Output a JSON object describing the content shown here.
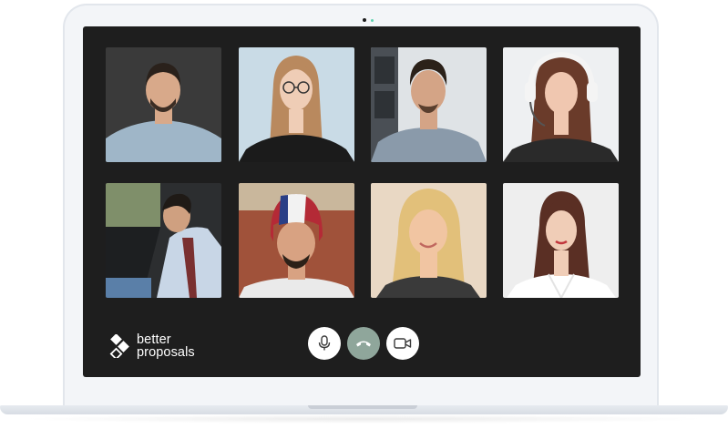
{
  "brand": {
    "line1": "better",
    "line2": "proposals"
  },
  "participants": [
    {
      "id": "p1",
      "bg": "#3a3a3a",
      "skin": "#d8a98a",
      "hair": "#2a211b",
      "shirt": "#9fb6c8"
    },
    {
      "id": "p2",
      "bg": "#c9dbe6",
      "skin": "#efcdb6",
      "hair": "#b9895e",
      "shirt": "#1b1b1b"
    },
    {
      "id": "p3",
      "bg": "#dfe3e6",
      "skin": "#d4a486",
      "hair": "#2b2119",
      "shirt": "#8a9aaa"
    },
    {
      "id": "p4",
      "bg": "#eef0f2",
      "skin": "#f0c7b0",
      "hair": "#6a3b2a",
      "shirt": "#2a2a2a"
    },
    {
      "id": "p5",
      "bg": "#7f8f6a",
      "skin": "#cfa080",
      "hair": "#1f1a16",
      "shirt": "#c8d6e6"
    },
    {
      "id": "p6",
      "bg": "#a0523a",
      "skin": "#d8a282",
      "hair": "#2c2118",
      "shirt": "#eaeaea"
    },
    {
      "id": "p7",
      "bg": "#e9d8c4",
      "skin": "#f1c5a2",
      "hair": "#e2c07a",
      "shirt": "#3a3a3a"
    },
    {
      "id": "p8",
      "bg": "#eeeeee",
      "skin": "#f0cdb7",
      "hair": "#5a2f24",
      "shirt": "#ffffff"
    }
  ],
  "controls": {
    "mic_icon": "microphone-icon",
    "end_icon": "phone-hangup-icon",
    "video_icon": "video-camera-icon",
    "end_color": "#8fa69b"
  }
}
